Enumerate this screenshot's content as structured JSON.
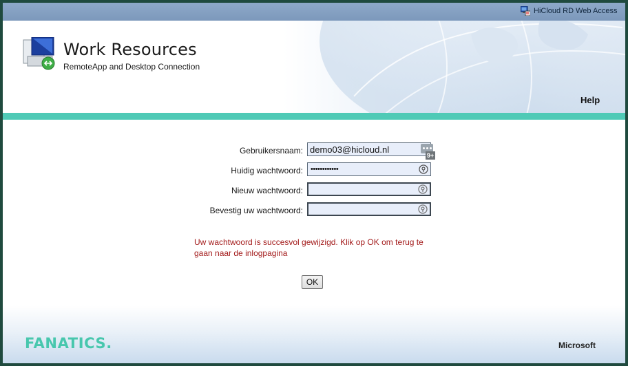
{
  "window": {
    "app_title": "HiCloud RD Web Access"
  },
  "header": {
    "title": "Work Resources",
    "subtitle": "RemoteApp and Desktop Connection",
    "help_label": "Help"
  },
  "form": {
    "username_label": "Gebruikersnaam:",
    "username_value": "demo03@hicloud.nl",
    "current_password_label": "Huidig wachtwoord:",
    "current_password_dots": "••••••••••••",
    "new_password_label": "Nieuw wachtwoord:",
    "confirm_password_label": "Bevestig uw wachtwoord:",
    "password_manager_badge": "9+"
  },
  "message": {
    "text": "Uw wachtwoord is succesvol gewijzigd. Klik op OK om terug te gaan naar de inlogpagina",
    "color": "#a31b1b"
  },
  "ok_button": {
    "label": "OK"
  },
  "footer": {
    "brand": "FANATICS.",
    "microsoft": "Microsoft"
  },
  "colors": {
    "accent_stripe": "#4fcab6",
    "brand": "#48c7ad",
    "topbar": "#8ea9c9"
  },
  "icons": [
    "remote-desktop-icon",
    "workspace-logo-icon",
    "password-key-icon",
    "password-manager-icon"
  ]
}
